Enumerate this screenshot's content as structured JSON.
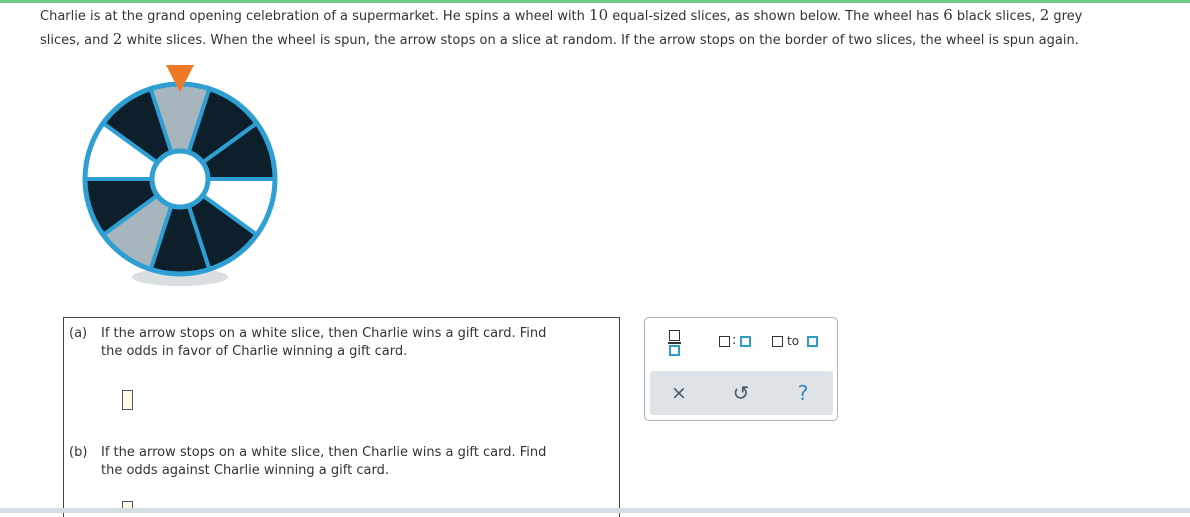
{
  "problem": {
    "sentence1_before": "Charlie is at the grand opening celebration of a supermarket. He spins a wheel with ",
    "num_slices": "10",
    "sentence1_mid": " equal-sized slices, as shown below. The wheel has ",
    "num_black": "6",
    "sentence1_black": " black slices, ",
    "num_grey": "2",
    "sentence1_grey": " grey",
    "line2_start": "slices, and ",
    "num_white": "2",
    "line2_rest": " white slices. When the wheel is spun, the arrow stops on a slice at random. If the arrow stops on the border of two slices, the wheel is spun again."
  },
  "wheel": {
    "slices": [
      "grey",
      "black",
      "black",
      "white",
      "black",
      "black",
      "grey",
      "black",
      "white",
      "black"
    ],
    "colors": {
      "black": "#0c1f2a",
      "grey": "#a7b6bd",
      "white": "#ffffff",
      "rim": "#2f9fd3",
      "pointer": "#ef7a26",
      "shadow": "#d9dee1"
    }
  },
  "questions": {
    "a": {
      "tag": "(a)",
      "line1": "If the arrow stops on a white slice, then Charlie wins a gift card. Find",
      "line2": "the odds in favor of Charlie winning a gift card."
    },
    "b": {
      "tag": "(b)",
      "line1": "If the arrow stops on a white slice, then Charlie wins a gift card. Find",
      "line2": "the odds against Charlie winning a gift card."
    }
  },
  "toolbar": {
    "ratio_colon": ":",
    "range_to": "to",
    "clear_symbol": "×",
    "undo_symbol": "↺",
    "help_symbol": "?"
  }
}
